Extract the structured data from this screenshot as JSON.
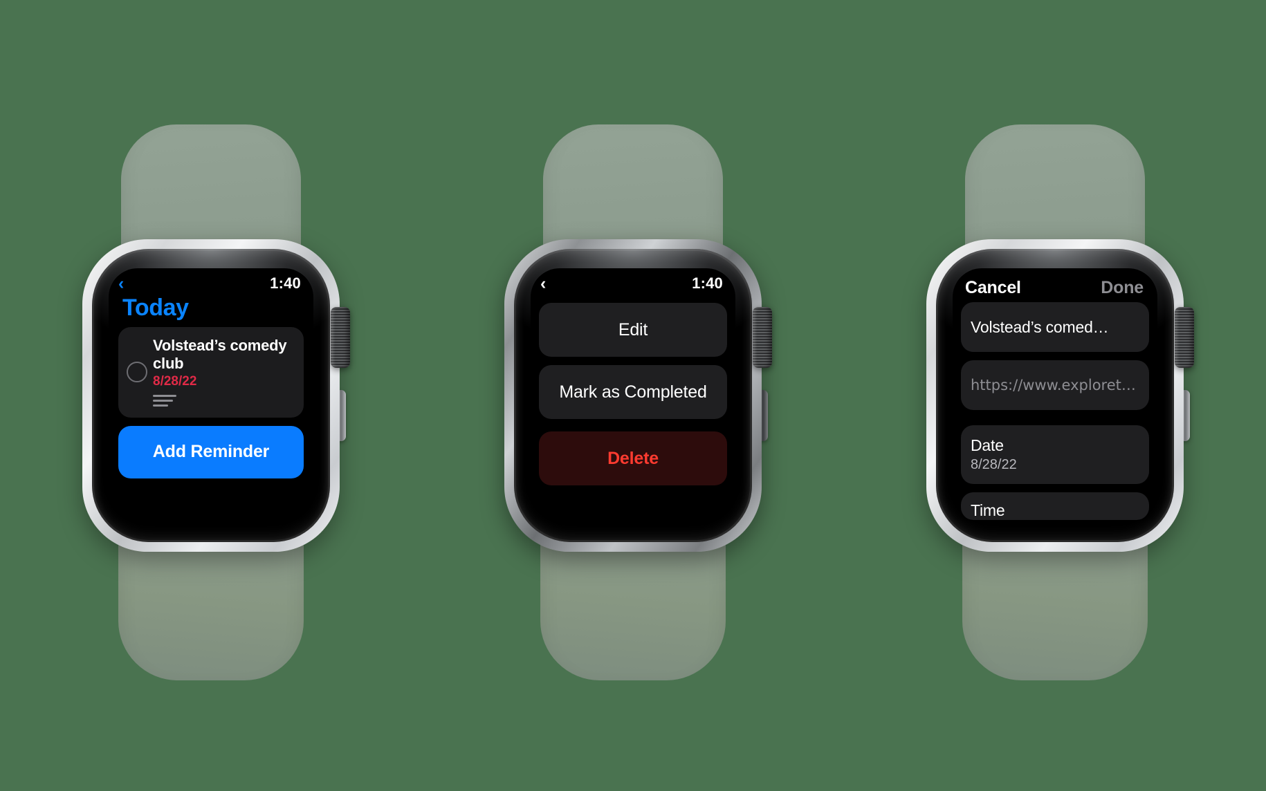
{
  "background_color": "#4a7350",
  "band_color": "#8b9b8d",
  "accent_blue": "#0a84ff",
  "accent_red": "#ff3b30",
  "date_red": "#e02a47",
  "watches": [
    {
      "case_finish": "silver",
      "screen": "today-list",
      "statusbar": {
        "back_icon": "chevron-left-icon",
        "time": "1:40"
      },
      "title": "Today",
      "reminder": {
        "checkbox_icon": "radio-circle-icon",
        "title": "Volstead’s comedy club",
        "date": "8/28/22",
        "notes_icon": "notes-lines-icon"
      },
      "add_button_label": "Add Reminder"
    },
    {
      "case_finish": "graphite",
      "screen": "action-menu",
      "statusbar": {
        "back_icon": "chevron-left-icon",
        "time": "1:40"
      },
      "menu_items": [
        {
          "label": "Edit",
          "style": "normal"
        },
        {
          "label": "Mark as Completed",
          "style": "normal"
        },
        {
          "label": "Delete",
          "style": "danger"
        }
      ]
    },
    {
      "case_finish": "silver",
      "screen": "edit-reminder",
      "header": {
        "cancel_label": "Cancel",
        "done_label": "Done"
      },
      "fields": [
        {
          "kind": "text",
          "value": "Volstead’s comed…"
        },
        {
          "kind": "url",
          "placeholder": "https://www.exploret…"
        },
        {
          "kind": "row",
          "label": "Date",
          "sub": "8/28/22"
        },
        {
          "kind": "row-cut",
          "label": "Time"
        }
      ]
    }
  ]
}
